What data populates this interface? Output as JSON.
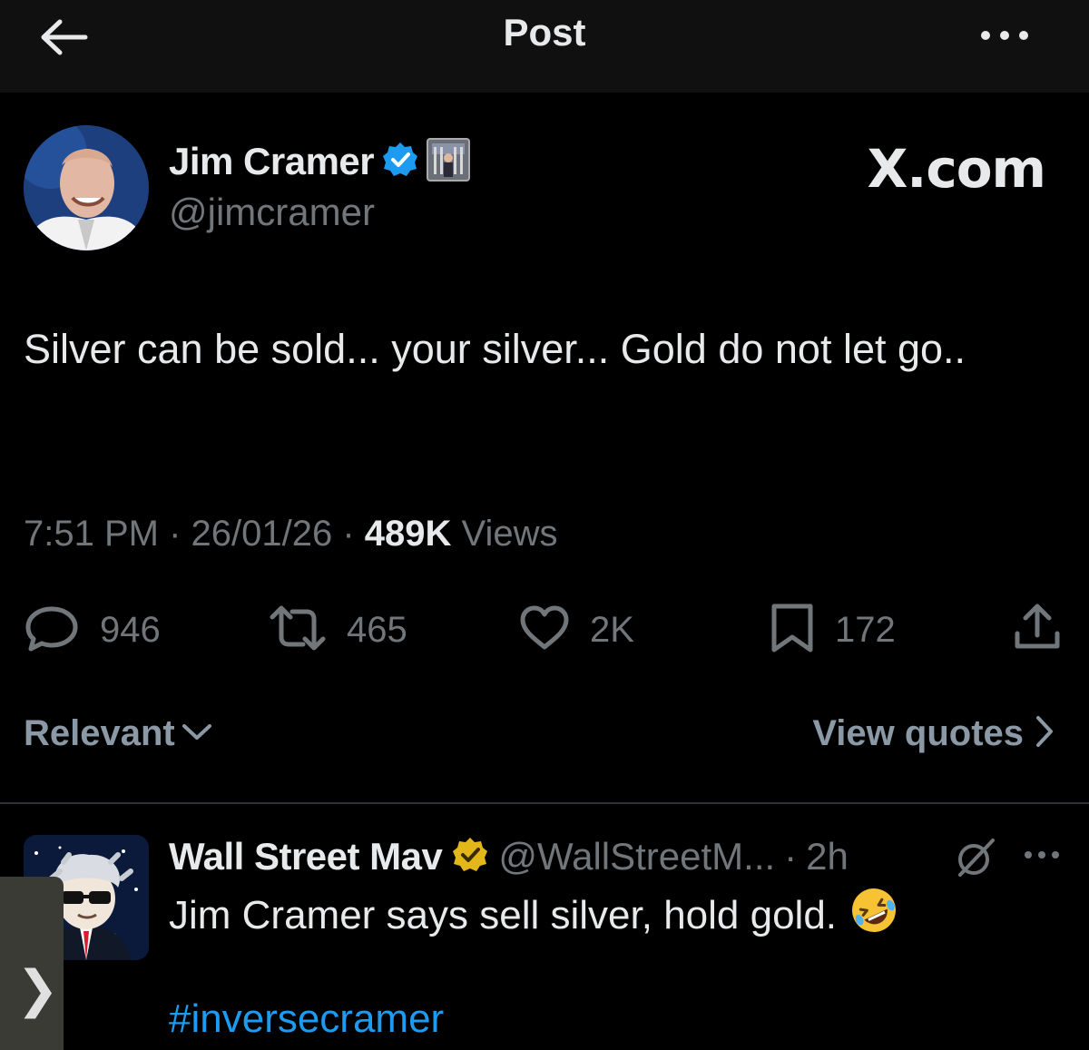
{
  "header": {
    "title": "Post"
  },
  "post": {
    "author": {
      "display_name": "Jim Cramer",
      "handle": "@jimcramer"
    },
    "watermark": "X.com",
    "text": "Silver can be sold... your silver... Gold do not let go..",
    "meta": {
      "time": "7:51 PM",
      "sep1": " · ",
      "date": "26/01/26",
      "sep2": " · ",
      "views_count": "489K",
      "views_label": " Views"
    },
    "actions": {
      "replies": "946",
      "reposts": "465",
      "likes": "2K",
      "bookmarks": "172"
    }
  },
  "replies_header": {
    "sort_label": "Relevant",
    "view_quotes_label": "View quotes"
  },
  "reply": {
    "display_name": "Wall Street Mav",
    "handle": "@WallStreetM...",
    "dot": "·",
    "time": "2h",
    "text": "Jim Cramer says sell silver, hold gold.",
    "hashtag": "#inversecramer"
  },
  "side_tab": {
    "label": "❯"
  },
  "colors": {
    "background": "#000000",
    "verified_blue": "#1d9bf0",
    "verified_gold": "#e2b719",
    "muted": "#71767b",
    "link": "#1d9bf0"
  }
}
